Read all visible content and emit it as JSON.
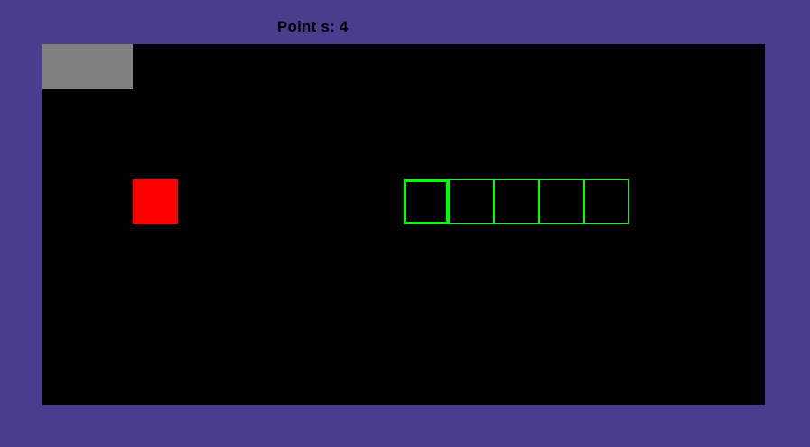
{
  "hud": {
    "score_text": "Point s: 4",
    "points": 4
  },
  "board": {
    "grid_cols": 16,
    "grid_rows": 8,
    "background_color": "#000000",
    "border_color": "#4a3d8c"
  },
  "obstacle": {
    "cell": [
      0,
      0
    ],
    "size_cells": [
      2,
      1
    ],
    "color": "#808080"
  },
  "food": {
    "cell": [
      2,
      3
    ],
    "color": "#ff0000"
  },
  "snake": {
    "color": "#00ff00",
    "direction": "left",
    "segments": [
      {
        "cell": [
          8,
          3
        ],
        "role": "head"
      },
      {
        "cell": [
          9,
          3
        ],
        "role": "body"
      },
      {
        "cell": [
          10,
          3
        ],
        "role": "body"
      },
      {
        "cell": [
          11,
          3
        ],
        "role": "body"
      },
      {
        "cell": [
          12,
          3
        ],
        "role": "body"
      }
    ]
  }
}
